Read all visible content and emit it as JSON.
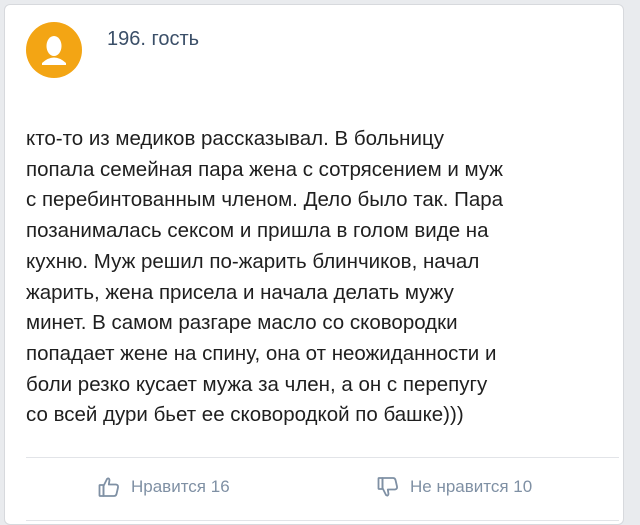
{
  "post": {
    "author": "196. гость",
    "text_lines": [
      "кто-то из медиков рассказывал. В больницу",
      "попала семейная пара жена с сотрясением и муж",
      "с перебинтованным членом. Дело было так. Пара",
      "позанималась сексом и пришла в голом виде на",
      "кухню. Муж решил по-жарить блинчиков, начал",
      "жарить, жена присела и начала делать мужу",
      "минет. В самом разгаре масло со сковородки",
      "попадает жене на спину, она от неожиданности и",
      "боли резко кусает мужа за член, а он с перепугу",
      "со всей дури бьет ее сковородкой по башке)))"
    ]
  },
  "actions": {
    "like_label": "Нравится 16",
    "dislike_label": "Не нравится 10"
  },
  "icons": {
    "avatar": "user-silhouette-icon",
    "like": "thumbs-up-icon",
    "dislike": "thumbs-down-icon"
  },
  "colors": {
    "avatar_bg": "#f3a514",
    "author": "#3b4f68",
    "action": "#7f90a4",
    "text": "#1f1f1f"
  }
}
